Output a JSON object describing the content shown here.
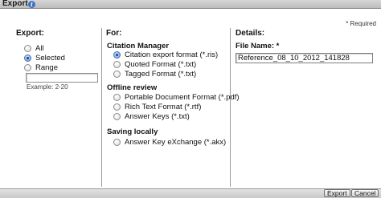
{
  "dialog": {
    "title": "Export",
    "required_note": "* Required"
  },
  "export_section": {
    "heading": "Export:",
    "options": [
      {
        "label": "All",
        "checked": false
      },
      {
        "label": "Selected",
        "checked": true
      },
      {
        "label": "Range",
        "checked": false
      }
    ],
    "range_value": "",
    "range_example": "Example: 2-20"
  },
  "for_section": {
    "heading": "For:",
    "groups": [
      {
        "title": "Citation Manager",
        "options": [
          {
            "label": "Citation export format (*.ris)",
            "checked": true
          },
          {
            "label": "Quoted Format (*.txt)",
            "checked": false
          },
          {
            "label": "Tagged Format (*.txt)",
            "checked": false
          }
        ]
      },
      {
        "title": "Offline review",
        "options": [
          {
            "label": "Portable Document Format (*.pdf)",
            "checked": false
          },
          {
            "label": "Rich Text Format (*.rtf)",
            "checked": false
          },
          {
            "label": "Answer Keys (*.txt)",
            "checked": false
          }
        ]
      },
      {
        "title": "Saving locally",
        "options": [
          {
            "label": "Answer Key eXchange (*.akx)",
            "checked": false
          }
        ]
      }
    ]
  },
  "details_section": {
    "heading": "Details:",
    "file_name_label": "File Name: *",
    "file_name_value": "Reference_08_10_2012_141828"
  },
  "buttons": {
    "export": "Export",
    "cancel": "Cancel"
  },
  "colors": {
    "radio_selected": "#6b9ae0",
    "info_icon": "#3f73c0"
  }
}
